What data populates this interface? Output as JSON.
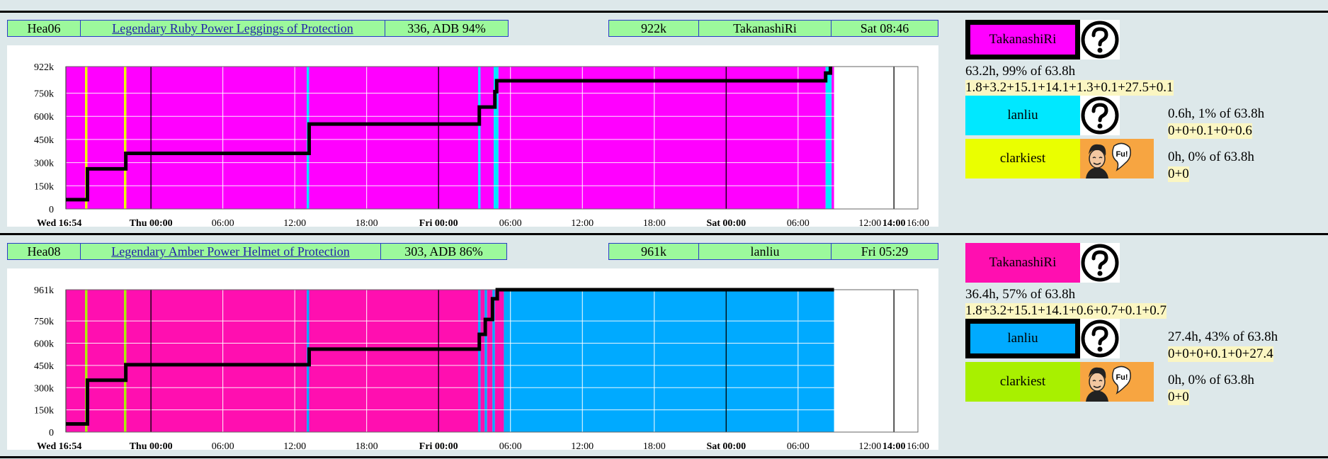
{
  "colors": {
    "TakanashiRi_p1": "#ff00ff",
    "TakanashiRi_p2": "#ff0fb0",
    "lanliu_p1": "#00e8ff",
    "lanliu_p2": "#00aaff",
    "clarkiest_p1": "#eaff00",
    "clarkiest_p2": "#a8f000",
    "infobar_bg": "#9cf99c",
    "price_line": "#000000"
  },
  "panels": [
    {
      "item_code": "Hea06",
      "item_name": "Legendary Ruby Power Leggings of Protection",
      "stats": "336, ADB 94%",
      "price": "922k",
      "winner": "TakanashiRi",
      "end_time": "Sat 08:46",
      "users": [
        {
          "name": "TakanashiRi",
          "color_key": "TakanashiRi_p1",
          "selected": true,
          "icon": "question-icon",
          "stat_line": "63.2h, 99% of 63.8h",
          "breakdown": "1.8+3.2+15.1+14.1+1.3+0.1+27.5+0.1"
        },
        {
          "name": "lanliu",
          "color_key": "lanliu_p1",
          "selected": false,
          "icon": "question-icon",
          "stat_line": "0.6h, 1% of 63.8h",
          "breakdown": "0+0+0.1+0+0.6"
        },
        {
          "name": "clarkiest",
          "color_key": "clarkiest_p1",
          "selected": false,
          "icon": "avatar-icon",
          "avatar_text": "Fu!",
          "stat_line": "0h, 0% of 63.8h",
          "breakdown": "0+0"
        }
      ],
      "chart_data": {
        "type": "line",
        "x_unit": "hours",
        "x_range": [
          0,
          71.1
        ],
        "y_range": [
          0,
          922
        ],
        "y_ticks": [
          {
            "v": 0,
            "label": "0"
          },
          {
            "v": 150,
            "label": "150k"
          },
          {
            "v": 300,
            "label": "300k"
          },
          {
            "v": 450,
            "label": "450k"
          },
          {
            "v": 600,
            "label": "600k"
          },
          {
            "v": 750,
            "label": "750k"
          },
          {
            "v": 922,
            "label": "922k"
          }
        ],
        "x_ticks": [
          {
            "h": 0,
            "label": "Wed 16:54",
            "bold": true
          },
          {
            "h": 7.1,
            "label": "Thu 00:00",
            "bold": true
          },
          {
            "h": 13.1,
            "label": "06:00",
            "bold": false
          },
          {
            "h": 19.1,
            "label": "12:00",
            "bold": false
          },
          {
            "h": 25.1,
            "label": "18:00",
            "bold": false
          },
          {
            "h": 31.1,
            "label": "Fri 00:00",
            "bold": true
          },
          {
            "h": 37.1,
            "label": "06:00",
            "bold": false
          },
          {
            "h": 43.1,
            "label": "12:00",
            "bold": false
          },
          {
            "h": 49.1,
            "label": "18:00",
            "bold": false
          },
          {
            "h": 55.1,
            "label": "Sat 00:00",
            "bold": true
          },
          {
            "h": 61.1,
            "label": "06:00",
            "bold": false
          },
          {
            "h": 67.1,
            "label": "12:00",
            "bold": false
          },
          {
            "h": 69.1,
            "label": "14:00",
            "bold": true
          },
          {
            "h": 71.1,
            "label": "16:00",
            "bold": false
          }
        ],
        "segments": [
          {
            "from": 0,
            "to": 1.6,
            "user": "TakanashiRi"
          },
          {
            "from": 1.6,
            "to": 1.8,
            "user": "clarkiest"
          },
          {
            "from": 1.8,
            "to": 4.85,
            "user": "TakanashiRi"
          },
          {
            "from": 4.85,
            "to": 5.05,
            "user": "clarkiest"
          },
          {
            "from": 5.05,
            "to": 20.1,
            "user": "TakanashiRi"
          },
          {
            "from": 20.1,
            "to": 20.3,
            "user": "lanliu"
          },
          {
            "from": 20.3,
            "to": 34.4,
            "user": "TakanashiRi"
          },
          {
            "from": 34.4,
            "to": 34.6,
            "user": "lanliu"
          },
          {
            "from": 34.6,
            "to": 35.7,
            "user": "TakanashiRi"
          },
          {
            "from": 35.7,
            "to": 36.1,
            "user": "lanliu"
          },
          {
            "from": 36.1,
            "to": 63.4,
            "user": "TakanashiRi"
          },
          {
            "from": 63.4,
            "to": 63.9,
            "user": "lanliu"
          },
          {
            "from": 63.9,
            "to": 64.1,
            "user": "TakanashiRi"
          }
        ],
        "price_points": [
          {
            "h": 0,
            "v": 60
          },
          {
            "h": 1.8,
            "v": 60
          },
          {
            "h": 1.8,
            "v": 260
          },
          {
            "h": 5.0,
            "v": 260
          },
          {
            "h": 5.0,
            "v": 360
          },
          {
            "h": 20.3,
            "v": 360
          },
          {
            "h": 20.3,
            "v": 550
          },
          {
            "h": 34.5,
            "v": 550
          },
          {
            "h": 34.5,
            "v": 660
          },
          {
            "h": 35.8,
            "v": 660
          },
          {
            "h": 35.8,
            "v": 760
          },
          {
            "h": 35.95,
            "v": 760
          },
          {
            "h": 35.95,
            "v": 830
          },
          {
            "h": 63.4,
            "v": 830
          },
          {
            "h": 63.4,
            "v": 880
          },
          {
            "h": 63.8,
            "v": 880
          },
          {
            "h": 63.8,
            "v": 922
          }
        ]
      }
    },
    {
      "item_code": "Hea08",
      "item_name": "Legendary Amber Power Helmet of Protection",
      "stats": "303, ADB 86%",
      "price": "961k",
      "winner": "lanliu",
      "end_time": "Fri 05:29",
      "users": [
        {
          "name": "TakanashiRi",
          "color_key": "TakanashiRi_p2",
          "selected": false,
          "icon": "question-icon",
          "stat_line": "36.4h, 57% of 63.8h",
          "breakdown": "1.8+3.2+15.1+14.1+0.6+0.7+0.1+0.7"
        },
        {
          "name": "lanliu",
          "color_key": "lanliu_p2",
          "selected": true,
          "icon": "question-icon",
          "stat_line": "27.4h, 43% of 63.8h",
          "breakdown": "0+0+0+0.1+0+27.4"
        },
        {
          "name": "clarkiest",
          "color_key": "clarkiest_p2",
          "selected": false,
          "icon": "avatar-icon",
          "avatar_text": "Fu!",
          "stat_line": "0h, 0% of 63.8h",
          "breakdown": "0+0"
        }
      ],
      "chart_data": {
        "type": "line",
        "x_unit": "hours",
        "x_range": [
          0,
          71.1
        ],
        "y_range": [
          0,
          961
        ],
        "y_ticks": [
          {
            "v": 0,
            "label": "0"
          },
          {
            "v": 150,
            "label": "150k"
          },
          {
            "v": 300,
            "label": "300k"
          },
          {
            "v": 450,
            "label": "450k"
          },
          {
            "v": 600,
            "label": "600k"
          },
          {
            "v": 750,
            "label": "750k"
          },
          {
            "v": 961,
            "label": "961k"
          }
        ],
        "x_ticks": [
          {
            "h": 0,
            "label": "Wed 16:54",
            "bold": true
          },
          {
            "h": 7.1,
            "label": "Thu 00:00",
            "bold": true
          },
          {
            "h": 13.1,
            "label": "06:00",
            "bold": false
          },
          {
            "h": 19.1,
            "label": "12:00",
            "bold": false
          },
          {
            "h": 25.1,
            "label": "18:00",
            "bold": false
          },
          {
            "h": 31.1,
            "label": "Fri 00:00",
            "bold": true
          },
          {
            "h": 37.1,
            "label": "06:00",
            "bold": false
          },
          {
            "h": 43.1,
            "label": "12:00",
            "bold": false
          },
          {
            "h": 49.1,
            "label": "18:00",
            "bold": false
          },
          {
            "h": 55.1,
            "label": "Sat 00:00",
            "bold": true
          },
          {
            "h": 61.1,
            "label": "06:00",
            "bold": false
          },
          {
            "h": 67.1,
            "label": "12:00",
            "bold": false
          },
          {
            "h": 69.1,
            "label": "14:00",
            "bold": true
          },
          {
            "h": 71.1,
            "label": "16:00",
            "bold": false
          }
        ],
        "segments": [
          {
            "from": 0,
            "to": 1.6,
            "user": "TakanashiRi"
          },
          {
            "from": 1.6,
            "to": 1.8,
            "user": "clarkiest"
          },
          {
            "from": 1.8,
            "to": 4.85,
            "user": "TakanashiRi"
          },
          {
            "from": 4.85,
            "to": 5.05,
            "user": "clarkiest"
          },
          {
            "from": 5.05,
            "to": 20.1,
            "user": "TakanashiRi"
          },
          {
            "from": 20.1,
            "to": 20.3,
            "user": "lanliu"
          },
          {
            "from": 20.3,
            "to": 34.4,
            "user": "TakanashiRi"
          },
          {
            "from": 34.4,
            "to": 34.6,
            "user": "lanliu"
          },
          {
            "from": 34.6,
            "to": 34.95,
            "user": "TakanashiRi"
          },
          {
            "from": 34.95,
            "to": 35.15,
            "user": "lanliu"
          },
          {
            "from": 35.15,
            "to": 35.6,
            "user": "TakanashiRi"
          },
          {
            "from": 35.6,
            "to": 35.8,
            "user": "lanliu"
          },
          {
            "from": 35.8,
            "to": 36.55,
            "user": "TakanashiRi"
          },
          {
            "from": 36.55,
            "to": 64.1,
            "user": "lanliu"
          }
        ],
        "price_points": [
          {
            "h": 0,
            "v": 55
          },
          {
            "h": 1.8,
            "v": 55
          },
          {
            "h": 1.8,
            "v": 350
          },
          {
            "h": 5.0,
            "v": 350
          },
          {
            "h": 5.0,
            "v": 455
          },
          {
            "h": 20.3,
            "v": 455
          },
          {
            "h": 20.3,
            "v": 560
          },
          {
            "h": 34.5,
            "v": 560
          },
          {
            "h": 34.5,
            "v": 660
          },
          {
            "h": 35.0,
            "v": 660
          },
          {
            "h": 35.0,
            "v": 760
          },
          {
            "h": 35.6,
            "v": 760
          },
          {
            "h": 35.6,
            "v": 900
          },
          {
            "h": 36.0,
            "v": 900
          },
          {
            "h": 36.0,
            "v": 961
          },
          {
            "h": 64.1,
            "v": 961
          }
        ]
      }
    }
  ]
}
